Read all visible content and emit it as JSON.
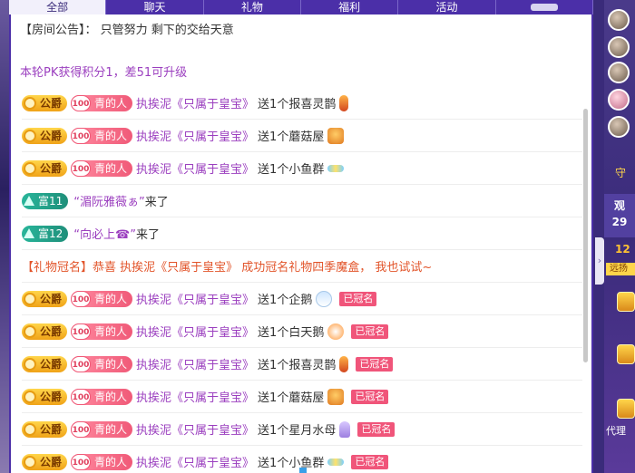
{
  "tabs": [
    "全部",
    "聊天",
    "礼物",
    "福利",
    "活动",
    ""
  ],
  "notice": "【房间公告】：  只管努力 剩下的交给天意",
  "pk_status": "本轮PK获得积分1，差51可升级",
  "labels": {
    "duke": "公爵",
    "fan_level": "100",
    "fan_club": "青的人",
    "crowned": "已冠名",
    "rich11": "富11",
    "rich12": "富12",
    "arrived": "来了"
  },
  "sender": "执挨泥《只属于皇宝》",
  "messages": [
    {
      "type": "gift",
      "text": "送1个报喜灵鹊",
      "icon": "magpie-gift-icon",
      "crowned": false
    },
    {
      "type": "gift",
      "text": "送1个蘑菇屋",
      "icon": "mushroom-house-gift-icon",
      "crowned": false
    },
    {
      "type": "gift",
      "text": "送1个小鱼群",
      "icon": "fish-school-gift-icon",
      "crowned": false
    },
    {
      "type": "enter",
      "rich": "富11",
      "guest": "“湄阮雅薇ぁ”"
    },
    {
      "type": "enter",
      "rich": "富12",
      "guest": "“向必上☎”"
    },
    {
      "type": "crown",
      "text": "【礼物冠名】恭喜 执挨泥《只属于皇宝》 成功冠名礼物四季魔盒， 我也试试~"
    },
    {
      "type": "gift",
      "text": "送1个企鹅",
      "icon": "penguin-gift-icon",
      "crowned": true
    },
    {
      "type": "gift",
      "text": "送1个白天鹅",
      "icon": "swan-gift-icon",
      "crowned": true
    },
    {
      "type": "gift",
      "text": "送1个报喜灵鹊",
      "icon": "magpie-gift-icon",
      "crowned": true
    },
    {
      "type": "gift",
      "text": "送1个蘑菇屋",
      "icon": "mushroom-house-gift-icon",
      "crowned": true
    },
    {
      "type": "gift",
      "text": "送1个星月水母",
      "icon": "jellyfish-gift-icon",
      "crowned": true
    },
    {
      "type": "gift",
      "text": "送1个小鱼群",
      "icon": "fish-school-gift-icon",
      "crowned": true
    }
  ],
  "sidebar": {
    "guard": "守",
    "watch_title": "观",
    "watch_count": "29",
    "ladder": "12",
    "ladder_sub": "远扬",
    "agent": "代理"
  },
  "colors": {
    "accent": "#4b2fa8",
    "username": "#9b3fbf",
    "crown_notice": "#e2542a",
    "crowned_badge": "#f0557a"
  }
}
